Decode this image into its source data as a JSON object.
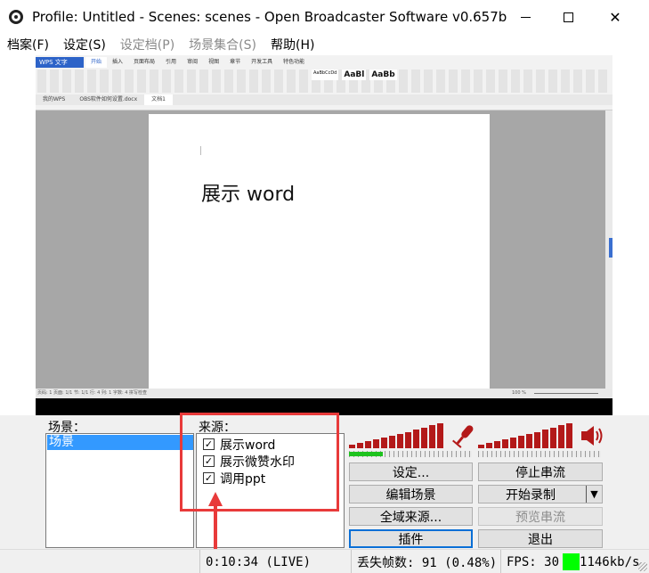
{
  "window": {
    "title": "Profile: Untitled - Scenes: scenes - Open Broadcaster Software v0.657b",
    "min_glyph": "—",
    "max_glyph": "☐",
    "close_glyph": "✕"
  },
  "menu": [
    {
      "label": "档案(F)",
      "enabled": true
    },
    {
      "label": "设定(S)",
      "enabled": true
    },
    {
      "label": "设定档(P)",
      "enabled": false
    },
    {
      "label": "场景集合(S)",
      "enabled": false
    },
    {
      "label": "帮助(H)",
      "enabled": true
    }
  ],
  "preview": {
    "wps": {
      "logo": "WPS 文字",
      "tabs": [
        "开始",
        "插入",
        "页面布局",
        "引用",
        "审阅",
        "视图",
        "章节",
        "开发工具",
        "特色功能"
      ],
      "styles": [
        "AaBbCcDd",
        "AaBl",
        "AaBb"
      ],
      "doc_tabs": [
        "我的WPS",
        "OBS软件如何设置.docx",
        "文档1"
      ],
      "status": "页码: 1  页面: 1/1  节: 1/1  行: 4  列: 1  字数: 4  拼写检查",
      "zoom": "100 %"
    },
    "document_text": "展示 word"
  },
  "scenes": {
    "label": "场景：",
    "items": [
      "场景"
    ],
    "selected": 0
  },
  "sources": {
    "label": "来源：",
    "items": [
      {
        "name": "展示word",
        "checked": true
      },
      {
        "name": "展示微赞水印",
        "checked": true
      },
      {
        "name": "调用ppt",
        "checked": true
      }
    ]
  },
  "audio": {
    "mic_icon": "microphone-icon",
    "speaker_icon": "speaker-icon",
    "mic_level": 0.35,
    "desktop_level": 0.0
  },
  "buttons": {
    "settings": "设定...",
    "stop_stream": "停止串流",
    "edit_scene": "编辑场景",
    "start_record": "开始录制",
    "global_sources": "全域来源...",
    "preview_stream": "预览串流",
    "plugins": "插件",
    "exit": "退出",
    "dropdown_glyph": "▼"
  },
  "status": {
    "time": "0:10:34 (LIVE)",
    "dropped": "丢失帧数: 91 (0.48%)",
    "fps": "FPS: 30",
    "bitrate": "1146kb/s",
    "fps_color": "#00ff00"
  },
  "colors": {
    "selection": "#3399ff",
    "meter": "#b31919",
    "highlight": "#e83a3a"
  }
}
